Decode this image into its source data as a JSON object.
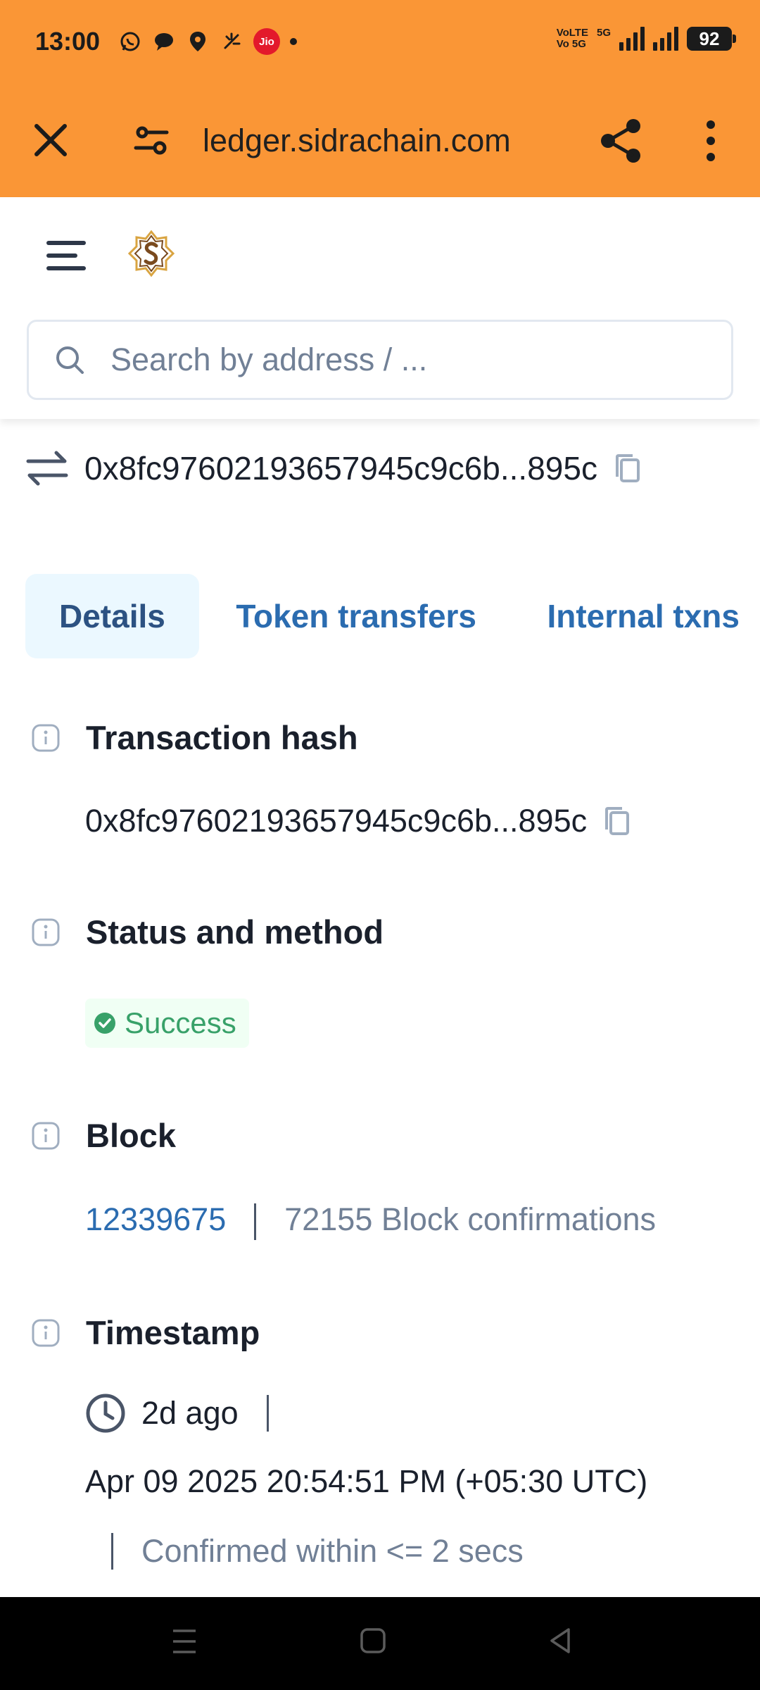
{
  "status_bar": {
    "time": "13:00",
    "carrier_badge": "Jio",
    "network_labels": [
      "VoLTE",
      "Vo 5G",
      "5G"
    ],
    "battery": "92"
  },
  "browser": {
    "url": "ledger.sidrachain.com",
    "close_icon": "close-icon",
    "site_info_icon": "tune-icon",
    "share_icon": "share-icon",
    "menu_icon": "more-vert-icon"
  },
  "header": {
    "search_placeholder": "Search by address / ..."
  },
  "tx": {
    "hash_short": "0x8fc97602193657945c9c6b...895c"
  },
  "tabs": [
    {
      "label": "Details",
      "active": true
    },
    {
      "label": "Token transfers",
      "active": false
    },
    {
      "label": "Internal txns",
      "active": false
    }
  ],
  "details": {
    "transaction_hash": {
      "label": "Transaction hash",
      "value": "0x8fc97602193657945c9c6b...895c"
    },
    "status": {
      "label": "Status and method",
      "badge": "Success"
    },
    "block": {
      "label": "Block",
      "number": "12339675",
      "confirmations": "72155 Block confirmations"
    },
    "timestamp": {
      "label": "Timestamp",
      "relative": "2d ago",
      "absolute": "Apr 09 2025 20:54:51 PM (+05:30 UTC)",
      "confirmed": "Confirmed within <= 2 secs"
    }
  },
  "colors": {
    "browser_bar": "#fa9636",
    "link": "#2b6cb0",
    "success": "#38a169",
    "active_tab_bg": "#ebf8ff"
  }
}
